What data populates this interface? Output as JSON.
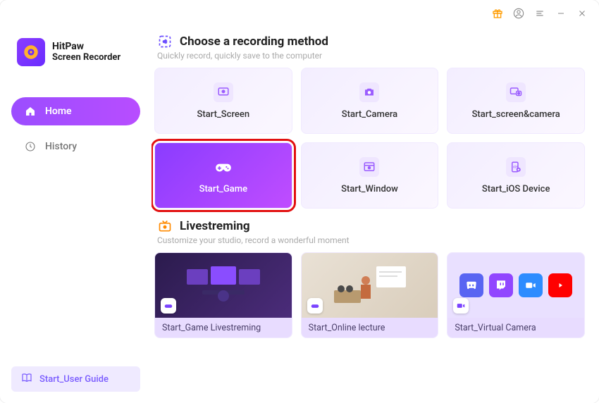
{
  "app": {
    "name": "HitPaw",
    "subtitle": "Screen Recorder"
  },
  "titlebar": {
    "icons": [
      "gift-icon",
      "user-icon",
      "menu-icon",
      "minimize-icon",
      "close-icon"
    ]
  },
  "sidebar": {
    "items": [
      {
        "label": "Home",
        "icon": "home-icon",
        "active": true
      },
      {
        "label": "History",
        "icon": "clock-icon",
        "active": false
      }
    ],
    "guide_label": "Start_User Guide"
  },
  "recording": {
    "title": "Choose a recording method",
    "subtitle": "Quickly record, quickly save to the computer",
    "cards": [
      {
        "label": "Start_Screen",
        "icon": "screen-icon"
      },
      {
        "label": "Start_Camera",
        "icon": "camera-icon"
      },
      {
        "label": "Start_screen&camera",
        "icon": "screen-camera-icon"
      },
      {
        "label": "Start_Game",
        "icon": "gamepad-icon",
        "selected": true,
        "highlighted": true
      },
      {
        "label": "Start_Window",
        "icon": "window-icon"
      },
      {
        "label": "Start_iOS Device",
        "icon": "ios-icon"
      }
    ]
  },
  "livestreaming": {
    "title": "Livestreming",
    "subtitle": "Customize your studio, record a wonderful moment",
    "cards": [
      {
        "label": "Start_Game Livestreming",
        "scene": "gamer",
        "badge": "gamepad-icon"
      },
      {
        "label": "Start_Online lecture",
        "scene": "lecture",
        "badge": "gamepad-icon"
      },
      {
        "label": "Start_Virtual Camera",
        "scene": "virtual",
        "badge": "camera-icon",
        "apps": [
          "discord",
          "twitch",
          "zoom",
          "youtube"
        ]
      }
    ]
  },
  "colors": {
    "accent": "#8a3cff",
    "highlight": "#e21010"
  }
}
